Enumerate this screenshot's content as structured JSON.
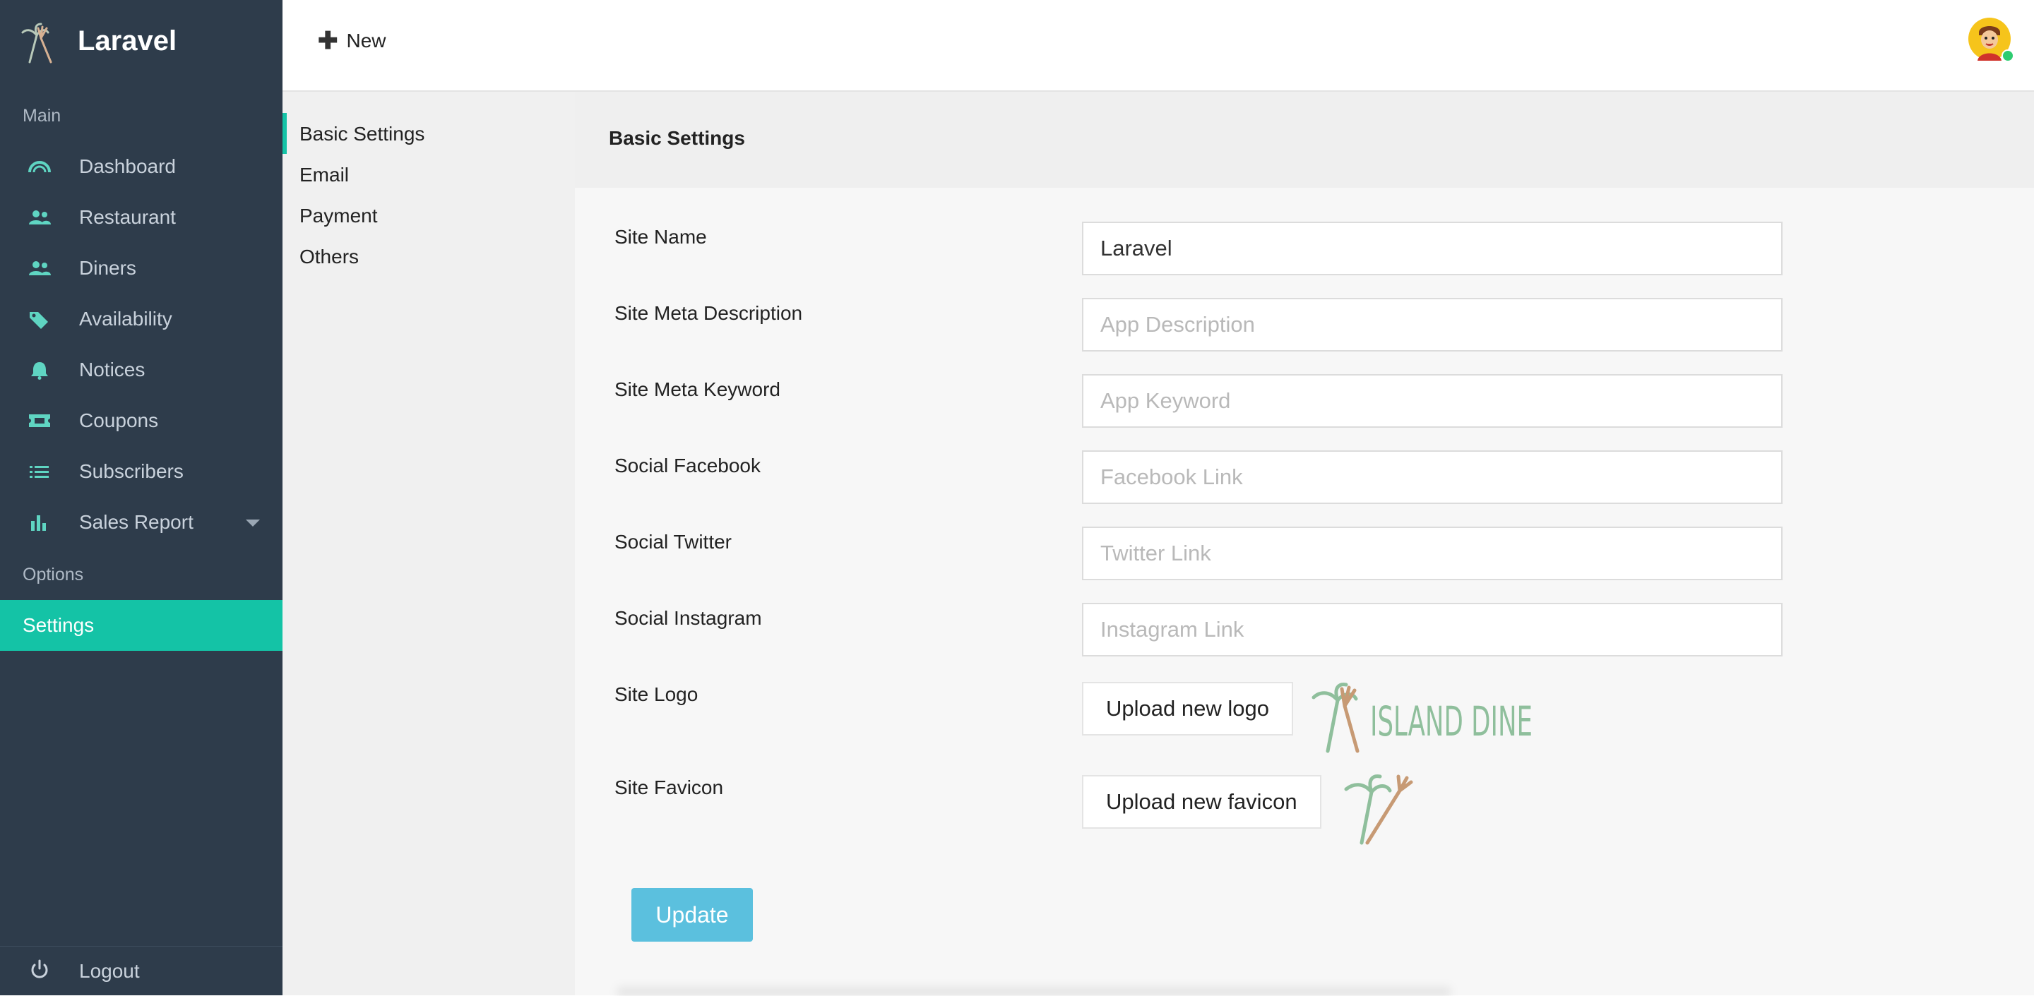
{
  "sidebar": {
    "brand": "Laravel",
    "section_main": "Main",
    "section_options": "Options",
    "items": [
      {
        "label": "Dashboard",
        "icon": "dashboard-gauge-icon"
      },
      {
        "label": "Restaurant",
        "icon": "users-icon"
      },
      {
        "label": "Diners",
        "icon": "users-icon"
      },
      {
        "label": "Availability",
        "icon": "tags-icon"
      },
      {
        "label": "Notices",
        "icon": "bell-icon"
      },
      {
        "label": "Coupons",
        "icon": "ticket-icon"
      },
      {
        "label": "Subscribers",
        "icon": "list-icon"
      },
      {
        "label": "Sales Report",
        "icon": "bar-chart-icon"
      }
    ],
    "settings": "Settings",
    "logout": "Logout"
  },
  "topbar": {
    "new_label": "New"
  },
  "settings_nav": {
    "items": [
      "Basic Settings",
      "Email",
      "Payment",
      "Others"
    ],
    "active": "Basic Settings"
  },
  "content": {
    "title": "Basic Settings",
    "fields": {
      "site_name": {
        "label": "Site Name",
        "value": "Laravel",
        "placeholder": ""
      },
      "meta_description": {
        "label": "Site Meta Description",
        "value": "",
        "placeholder": "App Description"
      },
      "meta_keyword": {
        "label": "Site Meta Keyword",
        "value": "",
        "placeholder": "App Keyword"
      },
      "facebook": {
        "label": "Social Facebook",
        "value": "",
        "placeholder": "Facebook Link"
      },
      "twitter": {
        "label": "Social Twitter",
        "value": "",
        "placeholder": "Twitter Link"
      },
      "instagram": {
        "label": "Social Instagram",
        "value": "",
        "placeholder": "Instagram Link"
      }
    },
    "site_logo_label": "Site Logo",
    "upload_logo": "Upload new logo",
    "logo_text": "ISLAND DINE",
    "site_favicon_label": "Site Favicon",
    "upload_favicon": "Upload new favicon",
    "update": "Update"
  },
  "colors": {
    "sidebar_bg": "#2e3c4b",
    "accent": "#14c3a6",
    "update_button": "#5bc0de",
    "logo_green": "#8fbf9c",
    "logo_brown": "#c79a74"
  }
}
